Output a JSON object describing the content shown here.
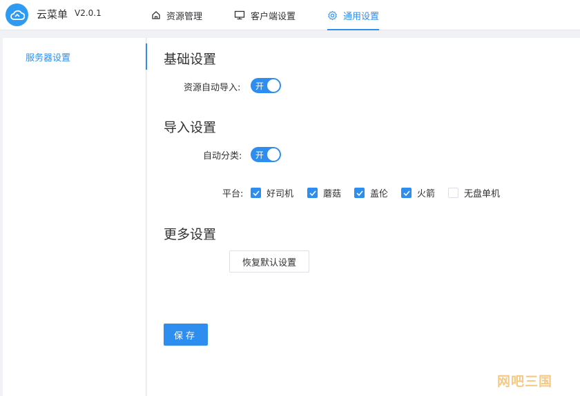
{
  "app": {
    "name": "云菜单",
    "version": "V2.0.1"
  },
  "nav": {
    "tabs": [
      {
        "label": "资源管理",
        "icon": "home-icon",
        "active": false
      },
      {
        "label": "客户端设置",
        "icon": "monitor-icon",
        "active": false
      },
      {
        "label": "通用设置",
        "icon": "gear-icon",
        "active": true
      }
    ]
  },
  "sidebar": {
    "items": [
      {
        "label": "服务器设置",
        "active": true
      }
    ]
  },
  "sections": {
    "basic": {
      "title": "基础设置",
      "auto_import_label": "资源自动导入:",
      "auto_import_switch": {
        "text": "开",
        "on": true
      }
    },
    "import": {
      "title": "导入设置",
      "auto_classify_label": "自动分类:",
      "auto_classify_switch": {
        "text": "开",
        "on": true
      },
      "platform_label": "平台:",
      "platforms": [
        {
          "label": "好司机",
          "checked": true
        },
        {
          "label": "蘑菇",
          "checked": true
        },
        {
          "label": "盖伦",
          "checked": true
        },
        {
          "label": "火箭",
          "checked": true
        },
        {
          "label": "无盘单机",
          "checked": false
        }
      ]
    },
    "more": {
      "title": "更多设置",
      "reset_label": "恢复默认设置"
    }
  },
  "save_label": "保存",
  "watermark": "网吧三国",
  "colors": {
    "accent": "#2e8ef0",
    "logo": "#2e9bf0",
    "watermark": "#f2b85a"
  }
}
